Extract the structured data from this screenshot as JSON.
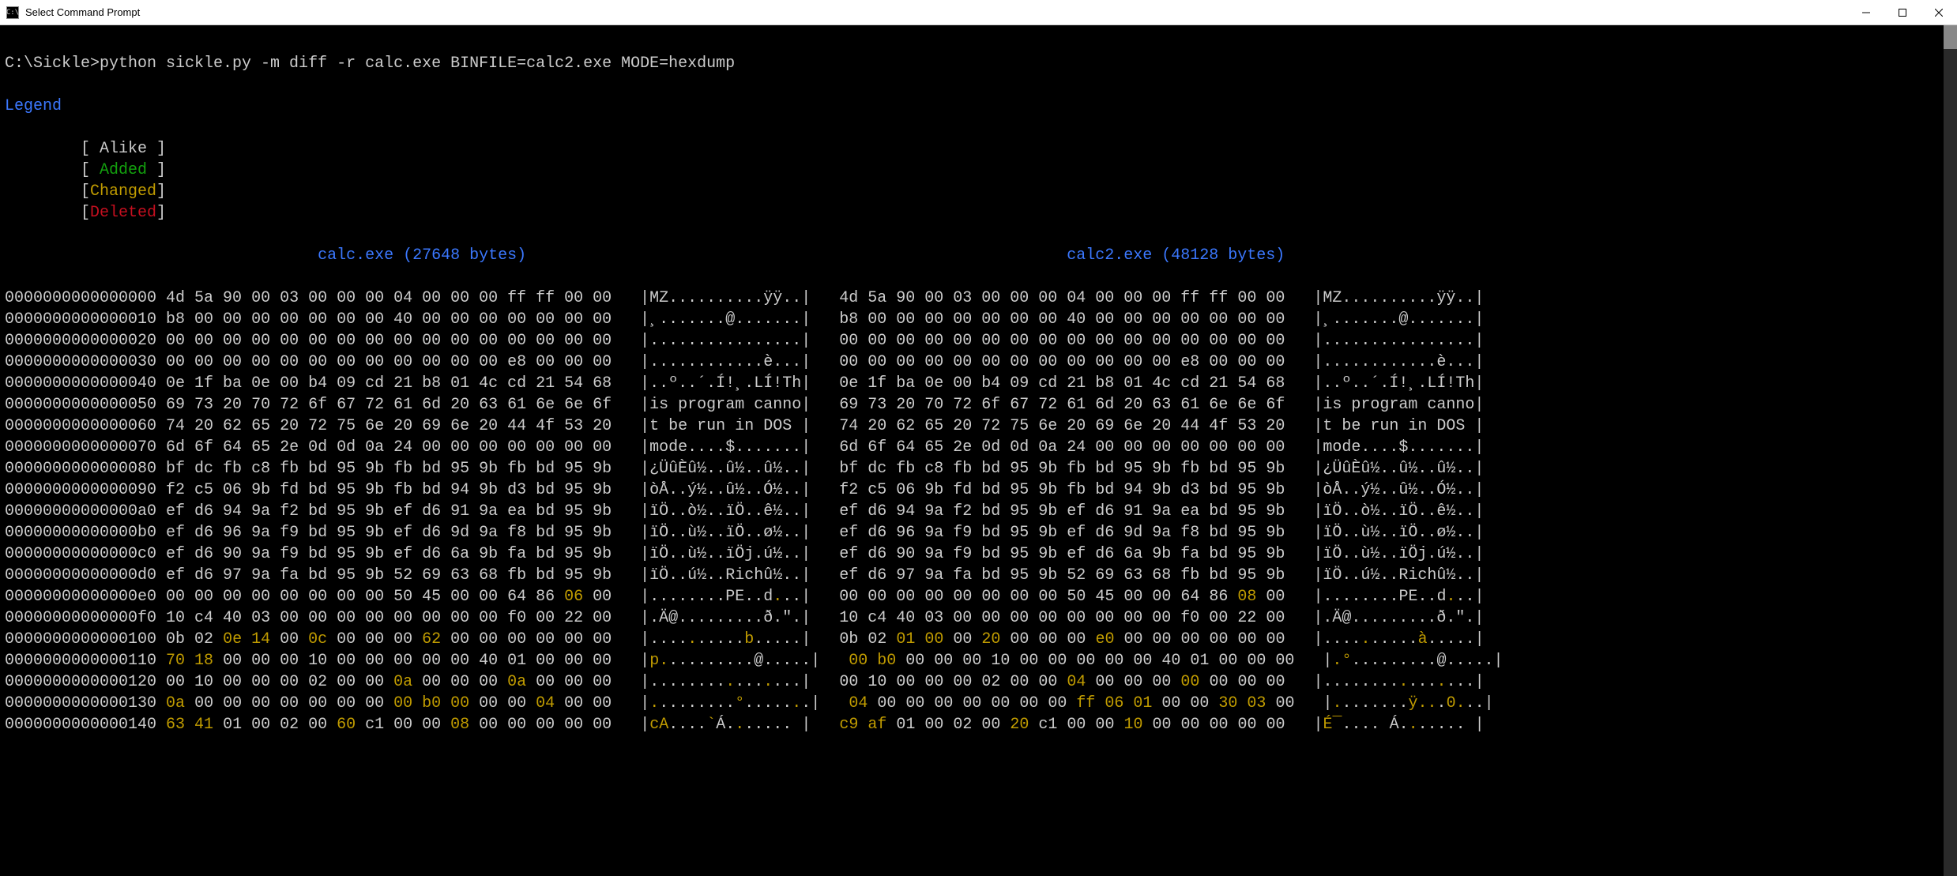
{
  "title": "Select Command Prompt",
  "prompt_prefix": "C:\\Sickle>",
  "command": "python sickle.py -m diff -r calc.exe BINFILE=calc2.exe MODE=hexdump",
  "legend": {
    "title": "Legend",
    "alike": "Alike",
    "added": "Added",
    "changed": "Changed",
    "deleted": "Deleted"
  },
  "headers": {
    "left": "calc.exe (27648 bytes)",
    "right": "calc2.exe (48128 bytes)"
  },
  "rows": [
    {
      "off": "0000000000000000",
      "lh": [
        [
          "4d 5a 90 00 03 00 00 00 04 00 00 00 ff ff 00 00",
          "w"
        ]
      ],
      "la": [
        [
          "MZ..........ÿÿ..",
          "w"
        ]
      ],
      "rh": [
        [
          "4d 5a 90 00 03 00 00 00 04 00 00 00 ff ff 00 00",
          "w"
        ]
      ],
      "ra": [
        [
          "MZ..........ÿÿ..",
          "w"
        ]
      ]
    },
    {
      "off": "0000000000000010",
      "lh": [
        [
          "b8 00 00 00 00 00 00 00 40 00 00 00 00 00 00 00",
          "w"
        ]
      ],
      "la": [
        [
          "¸.......@.......",
          "w"
        ]
      ],
      "rh": [
        [
          "b8 00 00 00 00 00 00 00 40 00 00 00 00 00 00 00",
          "w"
        ]
      ],
      "ra": [
        [
          "¸.......@.......",
          "w"
        ]
      ]
    },
    {
      "off": "0000000000000020",
      "lh": [
        [
          "00 00 00 00 00 00 00 00 00 00 00 00 00 00 00 00",
          "w"
        ]
      ],
      "la": [
        [
          "................",
          "w"
        ]
      ],
      "rh": [
        [
          "00 00 00 00 00 00 00 00 00 00 00 00 00 00 00 00",
          "w"
        ]
      ],
      "ra": [
        [
          "................",
          "w"
        ]
      ]
    },
    {
      "off": "0000000000000030",
      "lh": [
        [
          "00 00 00 00 00 00 00 00 00 00 00 00 e8 00 00 00",
          "w"
        ]
      ],
      "la": [
        [
          "............è...",
          "w"
        ]
      ],
      "rh": [
        [
          "00 00 00 00 00 00 00 00 00 00 00 00 e8 00 00 00",
          "w"
        ]
      ],
      "ra": [
        [
          "............è...",
          "w"
        ]
      ]
    },
    {
      "off": "0000000000000040",
      "lh": [
        [
          "0e 1f ba 0e 00 b4 09 cd 21 b8 01 4c cd 21 54 68",
          "w"
        ]
      ],
      "la": [
        [
          "..º..´.Í!¸.LÍ!Th",
          "w"
        ]
      ],
      "rh": [
        [
          "0e 1f ba 0e 00 b4 09 cd 21 b8 01 4c cd 21 54 68",
          "w"
        ]
      ],
      "ra": [
        [
          "..º..´.Í!¸.LÍ!Th",
          "w"
        ]
      ]
    },
    {
      "off": "0000000000000050",
      "lh": [
        [
          "69 73 20 70 72 6f 67 72 61 6d 20 63 61 6e 6e 6f",
          "w"
        ]
      ],
      "la": [
        [
          "is program canno",
          "w"
        ]
      ],
      "rh": [
        [
          "69 73 20 70 72 6f 67 72 61 6d 20 63 61 6e 6e 6f",
          "w"
        ]
      ],
      "ra": [
        [
          "is program canno",
          "w"
        ]
      ]
    },
    {
      "off": "0000000000000060",
      "lh": [
        [
          "74 20 62 65 20 72 75 6e 20 69 6e 20 44 4f 53 20",
          "w"
        ]
      ],
      "la": [
        [
          "t be run in DOS ",
          "w"
        ]
      ],
      "rh": [
        [
          "74 20 62 65 20 72 75 6e 20 69 6e 20 44 4f 53 20",
          "w"
        ]
      ],
      "ra": [
        [
          "t be run in DOS ",
          "w"
        ]
      ]
    },
    {
      "off": "0000000000000070",
      "lh": [
        [
          "6d 6f 64 65 2e 0d 0d 0a 24 00 00 00 00 00 00 00",
          "w"
        ]
      ],
      "la": [
        [
          "mode....$.......",
          "w"
        ]
      ],
      "rh": [
        [
          "6d 6f 64 65 2e 0d 0d 0a 24 00 00 00 00 00 00 00",
          "w"
        ]
      ],
      "ra": [
        [
          "mode....$.......",
          "w"
        ]
      ]
    },
    {
      "off": "0000000000000080",
      "lh": [
        [
          "bf dc fb c8 fb bd 95 9b fb bd 95 9b fb bd 95 9b",
          "w"
        ]
      ],
      "la": [
        [
          "¿ÜûÈû½..û½..û½..",
          "w"
        ]
      ],
      "rh": [
        [
          "bf dc fb c8 fb bd 95 9b fb bd 95 9b fb bd 95 9b",
          "w"
        ]
      ],
      "ra": [
        [
          "¿ÜûÈû½..û½..û½..",
          "w"
        ]
      ]
    },
    {
      "off": "0000000000000090",
      "lh": [
        [
          "f2 c5 06 9b fd bd 95 9b fb bd 94 9b d3 bd 95 9b",
          "w"
        ]
      ],
      "la": [
        [
          "òÅ..ý½..û½..Ó½..",
          "w"
        ]
      ],
      "rh": [
        [
          "f2 c5 06 9b fd bd 95 9b fb bd 94 9b d3 bd 95 9b",
          "w"
        ]
      ],
      "ra": [
        [
          "òÅ..ý½..û½..Ó½..",
          "w"
        ]
      ]
    },
    {
      "off": "00000000000000a0",
      "lh": [
        [
          "ef d6 94 9a f2 bd 95 9b ef d6 91 9a ea bd 95 9b",
          "w"
        ]
      ],
      "la": [
        [
          "ïÖ..ò½..ïÖ..ê½..",
          "w"
        ]
      ],
      "rh": [
        [
          "ef d6 94 9a f2 bd 95 9b ef d6 91 9a ea bd 95 9b",
          "w"
        ]
      ],
      "ra": [
        [
          "ïÖ..ò½..ïÖ..ê½..",
          "w"
        ]
      ]
    },
    {
      "off": "00000000000000b0",
      "lh": [
        [
          "ef d6 96 9a f9 bd 95 9b ef d6 9d 9a f8 bd 95 9b",
          "w"
        ]
      ],
      "la": [
        [
          "ïÖ..ù½..ïÖ..ø½..",
          "w"
        ]
      ],
      "rh": [
        [
          "ef d6 96 9a f9 bd 95 9b ef d6 9d 9a f8 bd 95 9b",
          "w"
        ]
      ],
      "ra": [
        [
          "ïÖ..ù½..ïÖ..ø½..",
          "w"
        ]
      ]
    },
    {
      "off": "00000000000000c0",
      "lh": [
        [
          "ef d6 90 9a f9 bd 95 9b ef d6 6a 9b fa bd 95 9b",
          "w"
        ]
      ],
      "la": [
        [
          "ïÖ..ù½..ïÖj.ú½..",
          "w"
        ]
      ],
      "rh": [
        [
          "ef d6 90 9a f9 bd 95 9b ef d6 6a 9b fa bd 95 9b",
          "w"
        ]
      ],
      "ra": [
        [
          "ïÖ..ù½..ïÖj.ú½..",
          "w"
        ]
      ]
    },
    {
      "off": "00000000000000d0",
      "lh": [
        [
          "ef d6 97 9a fa bd 95 9b 52 69 63 68 fb bd 95 9b",
          "w"
        ]
      ],
      "la": [
        [
          "ïÖ..ú½..Richû½..",
          "w"
        ]
      ],
      "rh": [
        [
          "ef d6 97 9a fa bd 95 9b 52 69 63 68 fb bd 95 9b",
          "w"
        ]
      ],
      "ra": [
        [
          "ïÖ..ú½..Richû½..",
          "w"
        ]
      ]
    },
    {
      "off": "00000000000000e0",
      "lh": [
        [
          "00 00 00 00 00 00 00 00 50 45 00 00 64 86 ",
          "w"
        ],
        [
          "06",
          "y"
        ],
        [
          " 00",
          "w"
        ]
      ],
      "la": [
        [
          "........PE..d",
          "w"
        ],
        [
          ".",
          "y"
        ],
        [
          "..",
          "w"
        ]
      ],
      "rh": [
        [
          "00 00 00 00 00 00 00 00 50 45 00 00 64 86 ",
          "w"
        ],
        [
          "08",
          "y"
        ],
        [
          " 00",
          "w"
        ]
      ],
      "ra": [
        [
          "........PE..d",
          "w"
        ],
        [
          ".",
          "y"
        ],
        [
          "..",
          "w"
        ]
      ]
    },
    {
      "off": "00000000000000f0",
      "lh": [
        [
          "10 c4 40 03 00 00 00 00 00 00 00 00 f0 00 22 00",
          "w"
        ]
      ],
      "la": [
        [
          ".Ä@.........ð.\".",
          "w"
        ]
      ],
      "rh": [
        [
          "10 c4 40 03 00 00 00 00 00 00 00 00 f0 00 22 00",
          "w"
        ]
      ],
      "ra": [
        [
          ".Ä@.........ð.\".",
          "w"
        ]
      ]
    },
    {
      "off": "0000000000000100",
      "lh": [
        [
          "0b 02 ",
          "w"
        ],
        [
          "0e 14",
          "y"
        ],
        [
          " 00 ",
          "w"
        ],
        [
          "0c",
          "y"
        ],
        [
          " 00 00 00 ",
          "w"
        ],
        [
          "62",
          "y"
        ],
        [
          " 00 00 00 00 00 00",
          "w"
        ]
      ],
      "la": [
        [
          "....",
          "w"
        ],
        [
          ".",
          "y"
        ],
        [
          ".....",
          "w"
        ],
        [
          "b",
          "y"
        ],
        [
          ".....",
          "w"
        ]
      ],
      "rh": [
        [
          "0b 02 ",
          "w"
        ],
        [
          "01 00",
          "y"
        ],
        [
          " 00 ",
          "w"
        ],
        [
          "20",
          "y"
        ],
        [
          " 00 00 00 ",
          "w"
        ],
        [
          "e0",
          "y"
        ],
        [
          " 00 00 00 00 00 00",
          "w"
        ]
      ],
      "ra": [
        [
          "....",
          "w"
        ],
        [
          ".",
          "y"
        ],
        [
          ".....",
          "w"
        ],
        [
          "à",
          "y"
        ],
        [
          ".....",
          "w"
        ]
      ]
    },
    {
      "off": "0000000000000110",
      "lh": [
        [
          "70 18",
          "y"
        ],
        [
          " 00 00 00 10 00 00 00 00 00 40 01 00 00 00",
          "w"
        ]
      ],
      "la": [
        [
          "p",
          "y"
        ],
        [
          ".",
          "y"
        ],
        [
          ".........@.....",
          "w"
        ]
      ],
      "rh": [
        [
          "00 b0",
          "y"
        ],
        [
          " 00 00 00 10 00 00 00 00 00 40 01 00 00 00",
          "w"
        ]
      ],
      "ra": [
        [
          ".",
          "y"
        ],
        [
          "°",
          "y"
        ],
        [
          ".........@.....",
          "w"
        ]
      ]
    },
    {
      "off": "0000000000000120",
      "lh": [
        [
          "00 10 00 00 00 02 00 00 ",
          "w"
        ],
        [
          "0a",
          "y"
        ],
        [
          " 00 00 00 ",
          "w"
        ],
        [
          "0a",
          "y"
        ],
        [
          " 00 00 00",
          "w"
        ]
      ],
      "la": [
        [
          "........",
          "w"
        ],
        [
          ".",
          "y"
        ],
        [
          "...",
          "w"
        ],
        [
          ".",
          "y"
        ],
        [
          "...",
          "w"
        ]
      ],
      "rh": [
        [
          "00 10 00 00 00 02 00 00 ",
          "w"
        ],
        [
          "04",
          "y"
        ],
        [
          " 00 00 00 ",
          "w"
        ],
        [
          "00",
          "y"
        ],
        [
          " 00 00 00",
          "w"
        ]
      ],
      "ra": [
        [
          "........",
          "w"
        ],
        [
          ".",
          "y"
        ],
        [
          "...",
          "w"
        ],
        [
          ".",
          "y"
        ],
        [
          "...",
          "w"
        ]
      ]
    },
    {
      "off": "0000000000000130",
      "lh": [
        [
          "0a",
          "y"
        ],
        [
          " 00 00 00 00 00 00 00 ",
          "w"
        ],
        [
          "00 b0 00",
          "y"
        ],
        [
          " 00 00 ",
          "w"
        ],
        [
          "04",
          "y"
        ],
        [
          " 00 00",
          "w"
        ]
      ],
      "la": [
        [
          ".",
          "y"
        ],
        [
          "........",
          "w"
        ],
        [
          "°",
          "y"
        ],
        [
          ".....",
          "w"
        ],
        [
          ".",
          "y"
        ],
        [
          ".",
          "w"
        ]
      ],
      "rh": [
        [
          "04",
          "y"
        ],
        [
          " 00 00 00 00 00 00 00 ",
          "w"
        ],
        [
          "ff 06 01",
          "y"
        ],
        [
          " 00 00 ",
          "w"
        ],
        [
          "30 03",
          "y"
        ],
        [
          " 00",
          "w"
        ]
      ],
      "ra": [
        [
          ".",
          "y"
        ],
        [
          ".......",
          "w"
        ],
        [
          "ÿ.",
          "y"
        ],
        [
          ".",
          "y"
        ],
        [
          ".",
          "w"
        ],
        [
          "0",
          "y"
        ],
        [
          ".",
          "y"
        ],
        [
          "..",
          "w"
        ]
      ]
    },
    {
      "off": "0000000000000140",
      "lh": [
        [
          "63 41",
          "y"
        ],
        [
          " 01 00 02 00 ",
          "w"
        ],
        [
          "60",
          "y"
        ],
        [
          " c1 00 00 ",
          "w"
        ],
        [
          "08",
          "y"
        ],
        [
          " 00 00 00 00 00",
          "w"
        ]
      ],
      "la": [
        [
          "cA",
          "y"
        ],
        [
          "....",
          "w"
        ],
        [
          "`",
          "y"
        ],
        [
          "Á.",
          "w"
        ],
        [
          ".",
          "y"
        ],
        [
          ".....",
          "w"
        ]
      ],
      "rh": [
        [
          "c9 af",
          "y"
        ],
        [
          " 01 00 02 00 ",
          "w"
        ],
        [
          "20",
          "y"
        ],
        [
          " c1 00 00 ",
          "w"
        ],
        [
          "10",
          "y"
        ],
        [
          " 00 00 00 00 00",
          "w"
        ]
      ],
      "ra": [
        [
          "É¯",
          "y"
        ],
        [
          "....",
          "w"
        ],
        [
          " ",
          "y"
        ],
        [
          "Á.",
          "w"
        ],
        [
          ".",
          "y"
        ],
        [
          ".....",
          "w"
        ]
      ]
    }
  ]
}
